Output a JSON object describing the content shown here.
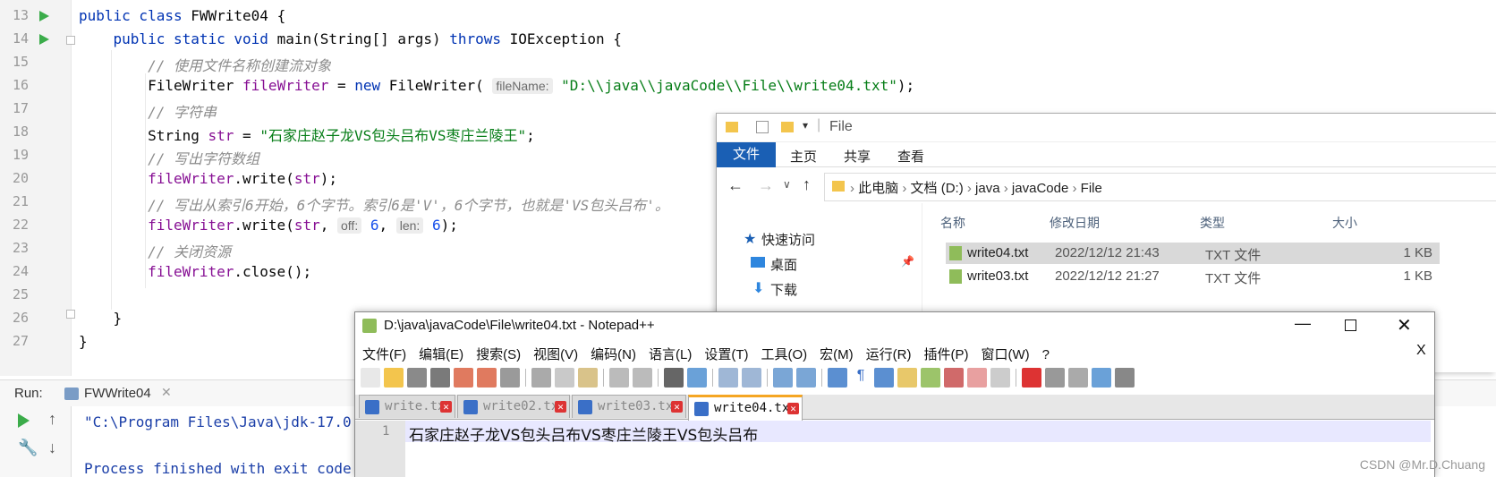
{
  "ide": {
    "line_numbers": [
      "13",
      "14",
      "15",
      "16",
      "17",
      "18",
      "19",
      "20",
      "21",
      "22",
      "23",
      "24",
      "25",
      "26",
      "27"
    ],
    "code": {
      "l13a": "public class ",
      "l13b": "FWWrite04 {",
      "l14a": "    public static void ",
      "l14b": "main(String[] args) ",
      "l14c": "throws ",
      "l14d": "IOException {",
      "l15": "        // 使用文件名称创建流对象",
      "l16a": "        FileWriter ",
      "l16b": "fileWriter",
      " l16c": " = ",
      "l16d": "new ",
      "l16e": "FileWriter( ",
      "l16hint": "fileName:",
      "l16f": "\"D:\\\\java\\\\javaCode\\\\File\\\\write04.txt\"",
      "l16g": ");",
      "l17": "        // 字符串",
      "l18a": "        String ",
      "l18b": "str",
      " l18c": " = ",
      "l18d": "\"石家庄赵子龙VS包头吕布VS枣庄兰陵王\"",
      "l18e": ";",
      "l19": "        // 写出字符数组",
      "l20a": "        ",
      "l20b": "fileWriter",
      ".l20c": ".write(",
      "l20d": "str",
      "l20e": ");",
      "l21": "        // 写出从索引6开始，6个字节。索引6是'V'，6个字节，也就是'VS包头吕布'。",
      "l22a": "        ",
      "l22b": "fileWriter",
      "l22c": ".write(",
      "l22d": "str",
      ", l22e": ", ",
      "l22hint1": "off:",
      "l22f": "6",
      ", l22g": ", ",
      "l22hint2": "len:",
      "l22h": "6",
      "l22i": ");",
      "l23": "        // 关闭资源",
      "l24a": "        ",
      "l24b": "fileWriter",
      "l24c": ".close();",
      "l26": "    }",
      "l27": "}"
    },
    "run_label": "Run:",
    "run_tab": "FWWrite04",
    "console_line1": "\"C:\\Program Files\\Java\\jdk-17.0",
    "console_line2": "Process finished with exit code"
  },
  "explorer": {
    "title": "File",
    "ribbon_tabs": [
      "文件",
      "主页",
      "共享",
      "查看"
    ],
    "breadcrumb": [
      "此电脑",
      "文档 (D:)",
      "java",
      "javaCode",
      "File"
    ],
    "nav": [
      "快速访问",
      "桌面",
      "下载"
    ],
    "columns": [
      "名称",
      "修改日期",
      "类型",
      "大小"
    ],
    "files": [
      {
        "name": "write04.txt",
        "date": "2022/12/12 21:43",
        "type": "TXT 文件",
        "size": "1 KB"
      },
      {
        "name": "write03.txt",
        "date": "2022/12/12 21:27",
        "type": "TXT 文件",
        "size": "1 KB"
      }
    ]
  },
  "npp": {
    "title": "D:\\java\\javaCode\\File\\write04.txt - Notepad++",
    "menu": [
      "文件(F)",
      "编辑(E)",
      "搜索(S)",
      "视图(V)",
      "编码(N)",
      "语言(L)",
      "设置(T)",
      "工具(O)",
      "宏(M)",
      "运行(R)",
      "插件(P)",
      "窗口(W)",
      "?"
    ],
    "close_x": "X",
    "tabs": [
      "write.txt",
      "write02.txt",
      "write03.txt",
      "write04.txt"
    ],
    "line_no": "1",
    "content": "石家庄赵子龙VS包头吕布VS枣庄兰陵王VS包头吕布"
  },
  "watermark": "CSDN @Mr.D.Chuang",
  "colors": {
    "keyword": "#0033b3",
    "string": "#067d17",
    "comment": "#8c8c8c",
    "field": "#871094",
    "accent": "#1a5fb4"
  }
}
